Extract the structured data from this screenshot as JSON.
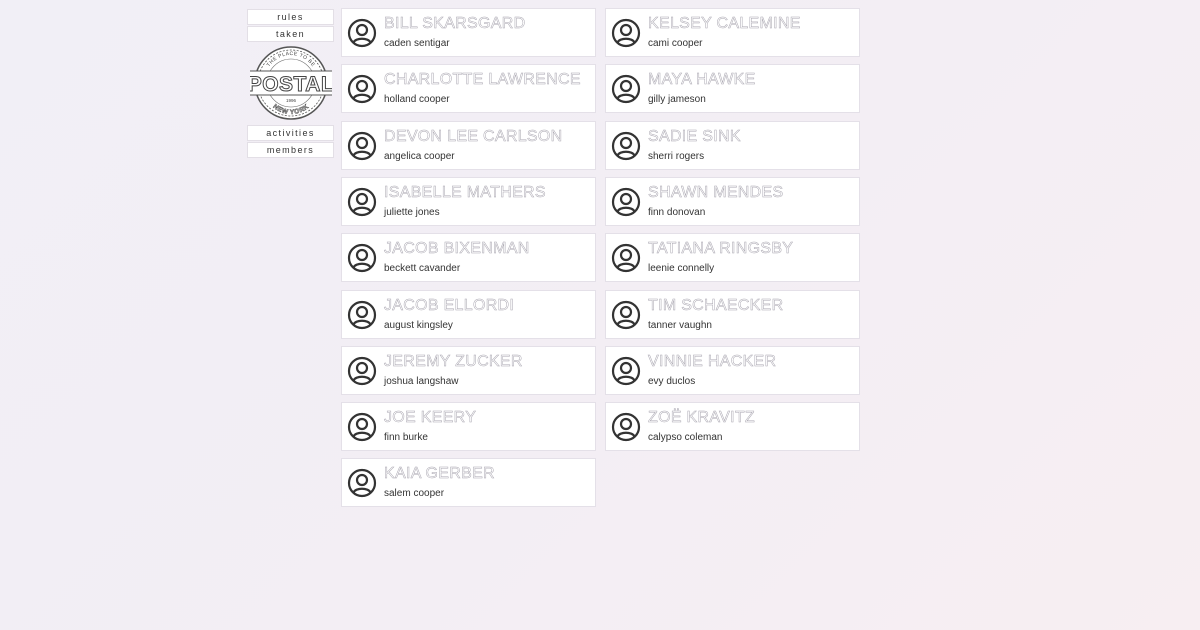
{
  "sidebar": {
    "top_links": [
      {
        "label": "rules",
        "name": "rules-link"
      },
      {
        "label": "taken",
        "name": "taken-link"
      }
    ],
    "logo": {
      "text": "POSTAL",
      "arc_text": "THE PLACE TO BE",
      "city": "NEW YORK",
      "year": "1996"
    },
    "bottom_links": [
      {
        "label": "activities",
        "name": "activities-link"
      },
      {
        "label": "members",
        "name": "members-link"
      }
    ]
  },
  "characters": [
    {
      "character": "BILL SKARSGARD",
      "member": "caden sentigar"
    },
    {
      "character": "KELSEY CALEMINE",
      "member": "cami cooper"
    },
    {
      "character": "CHARLOTTE LAWRENCE",
      "member": "holland cooper"
    },
    {
      "character": "MAYA HAWKE",
      "member": "gilly jameson"
    },
    {
      "character": "DEVON LEE CARLSON",
      "member": "angelica cooper"
    },
    {
      "character": "SADIE SINK",
      "member": "sherri rogers"
    },
    {
      "character": "ISABELLE MATHERS",
      "member": "juliette jones"
    },
    {
      "character": "SHAWN MENDES",
      "member": "finn donovan"
    },
    {
      "character": "JACOB BIXENMAN",
      "member": "beckett cavander"
    },
    {
      "character": "TATIANA RINGSBY",
      "member": "leenie connelly"
    },
    {
      "character": "JACOB ELLORDI",
      "member": "august kingsley"
    },
    {
      "character": "TIM SCHAECKER",
      "member": "tanner vaughn"
    },
    {
      "character": "JEREMY ZUCKER",
      "member": "joshua langshaw"
    },
    {
      "character": "VINNIE HACKER",
      "member": "evy duclos"
    },
    {
      "character": "JOE KEERY",
      "member": "finn burke"
    },
    {
      "character": "ZOË KRAVITZ",
      "member": "calypso coleman"
    },
    {
      "character": "KAIA GERBER",
      "member": "salem cooper"
    }
  ],
  "icons": {
    "avatar": "user-circle-icon"
  },
  "colors": {
    "card_bg": "#ffffff",
    "name_outline": "#a9a6b0",
    "text": "#333333"
  }
}
